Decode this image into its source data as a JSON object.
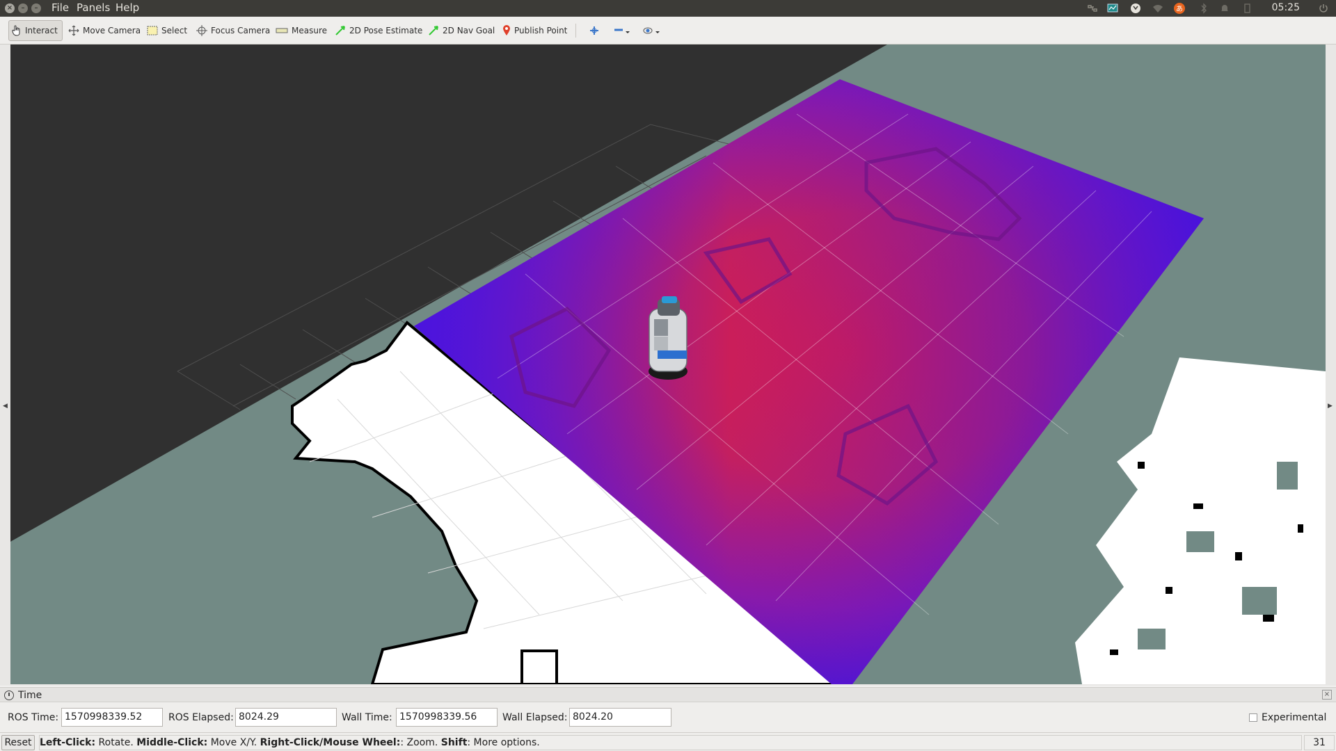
{
  "menubar": {
    "menus": [
      "File",
      "Panels",
      "Help"
    ],
    "clock": "05:25"
  },
  "toolbar": {
    "tools": [
      {
        "label": "Interact",
        "icon": "hand-pointer-icon",
        "active": true
      },
      {
        "label": "Move Camera",
        "icon": "move-arrows-icon",
        "active": false
      },
      {
        "label": "Select",
        "icon": "selection-box-icon",
        "active": false
      },
      {
        "label": "Focus Camera",
        "icon": "crosshair-icon",
        "active": false
      },
      {
        "label": "Measure",
        "icon": "ruler-icon",
        "active": false
      },
      {
        "label": "2D Pose Estimate",
        "icon": "green-arrow-icon",
        "active": false
      },
      {
        "label": "2D Nav Goal",
        "icon": "green-arrow-icon",
        "active": false
      },
      {
        "label": "Publish Point",
        "icon": "map-pin-icon",
        "active": false
      }
    ],
    "extra_icons": [
      "add-tool-icon",
      "remove-tool-icon",
      "view-eye-icon"
    ]
  },
  "time_panel": {
    "title": "Time",
    "ros_time_label": "ROS Time:",
    "ros_time": "1570998339.52",
    "ros_elapsed_label": "ROS Elapsed:",
    "ros_elapsed": "8024.29",
    "wall_time_label": "Wall Time:",
    "wall_time": "1570998339.56",
    "wall_elapsed_label": "Wall Elapsed:",
    "wall_elapsed": "8024.20",
    "experimental_label": "Experimental",
    "experimental_checked": false
  },
  "statusbar": {
    "reset_label": "Reset",
    "hint": [
      {
        "bold": "Left-Click:",
        "text": " Rotate. "
      },
      {
        "bold": "Middle-Click:",
        "text": " Move X/Y. "
      },
      {
        "bold": "Right-Click/Mouse Wheel:",
        "text": ": Zoom. "
      },
      {
        "bold": "Shift",
        "text": ": More options."
      }
    ],
    "fps": "31 fps"
  },
  "colors": {
    "background_3d": "#303030",
    "map_unknown": "#728a85",
    "costmap_high": "#d11f5a",
    "costmap_low": "#3a10e8",
    "free_space": "#ffffff"
  }
}
